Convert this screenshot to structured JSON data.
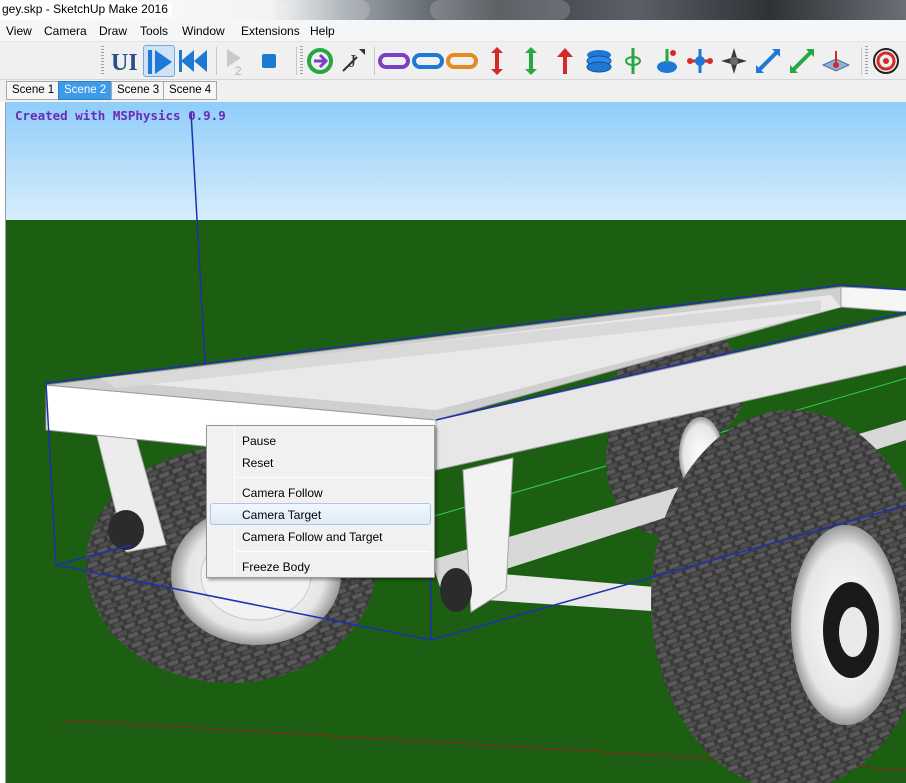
{
  "window": {
    "title": "gey.skp - SketchUp Make 2016"
  },
  "menu": [
    "View",
    "Camera",
    "Draw",
    "Tools",
    "Window",
    "Extensions",
    "Help"
  ],
  "toolbar": {
    "ui_label": "UI",
    "buttons": [
      "ui-toggle-icon",
      "play-icon",
      "rewind-icon",
      "record-icon",
      "stop-icon",
      "toggle-joint-icon",
      "joint-connect-icon",
      "connect-purple-icon",
      "connect-blue-icon",
      "connect-orange-icon",
      "slider-red-icon",
      "slider-green-icon",
      "thruster-icon",
      "spring-icon",
      "piston-icon",
      "hinge-icon",
      "universal-joint-icon",
      "fixed-joint-icon",
      "up-vector-blue-icon",
      "up-vector-green-icon",
      "plane-icon",
      "ball-joint-icon"
    ],
    "colors": {
      "play_blue": "#1e78d6",
      "joint_green": "#27a642",
      "purple": "#7a3fc2",
      "orange": "#e58a1e",
      "red": "#d42a2a"
    }
  },
  "scenes": {
    "tabs": [
      "Scene 1",
      "Scene 2",
      "Scene 3",
      "Scene 4"
    ],
    "active": "Scene 2"
  },
  "viewport": {
    "overlay_text": "Created with MSPhysics 0.9.9",
    "sky_color": "#a3d8fb",
    "ground_color": "#1c5f12"
  },
  "context_menu": {
    "groups": [
      [
        "Pause",
        "Reset"
      ],
      [
        "Camera Follow",
        "Camera Target",
        "Camera Follow and Target"
      ],
      [
        "Freeze Body"
      ]
    ],
    "highlighted": "Camera Target"
  }
}
